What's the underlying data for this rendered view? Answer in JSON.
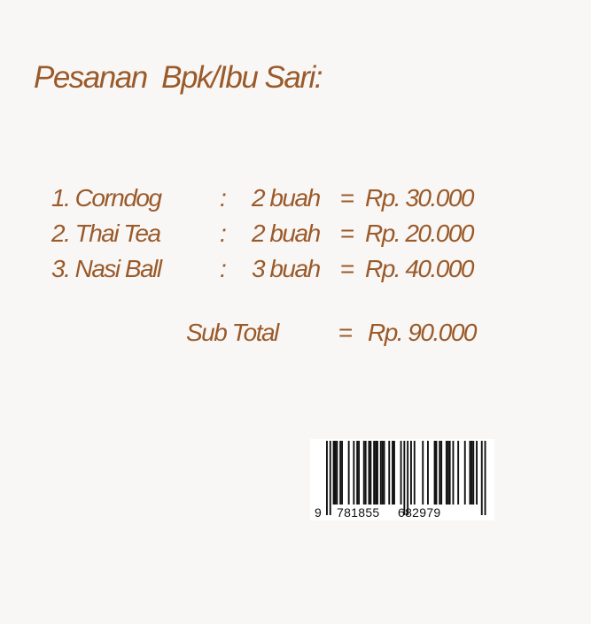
{
  "header": {
    "title": "Pesanan  Bpk/Ibu Sari:"
  },
  "order": {
    "items": [
      {
        "name": "1. Corndog",
        "separator": ":",
        "qty": "2 buah",
        "equals": "=",
        "price": "Rp. 30.000"
      },
      {
        "name": "2. Thai Tea",
        "separator": ":",
        "qty": "2 buah",
        "equals": "=",
        "price": "Rp. 20.000"
      },
      {
        "name": "3. Nasi Ball",
        "separator": ":",
        "qty": "3 buah",
        "equals": "=",
        "price": "Rp. 40.000"
      }
    ],
    "subtotal": {
      "label": "Sub Total",
      "equals": "=",
      "value": "Rp. 90.000"
    }
  },
  "barcode": {
    "first_digit": "9",
    "left_group": "781855",
    "right_group": "682979"
  },
  "colors": {
    "text": "#9a5a2a",
    "background": "#f9f7f5",
    "barcode": "#111111"
  }
}
